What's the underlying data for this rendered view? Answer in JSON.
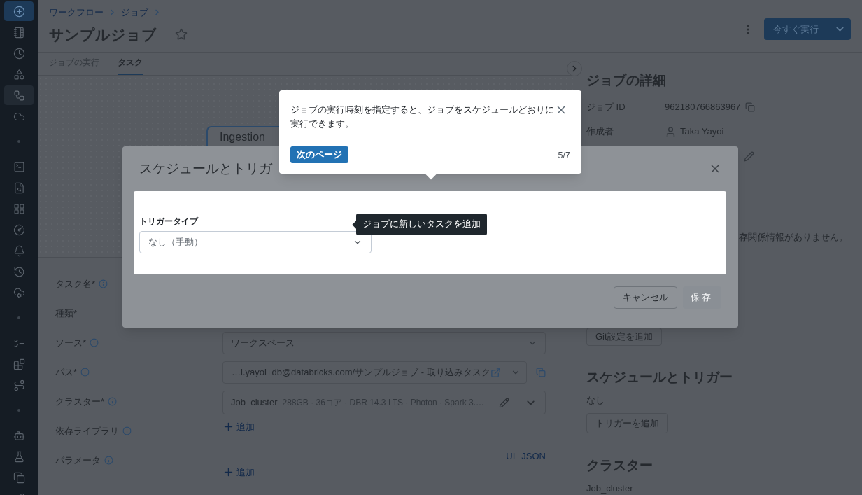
{
  "sidebar": {
    "groups": [
      [
        {
          "selected": false,
          "kind": "new"
        },
        {
          "selected": false
        },
        {
          "selected": false
        },
        {
          "selected": false
        },
        {
          "selected": true
        },
        {
          "selected": false
        }
      ],
      [
        {
          "selected": false
        },
        {
          "selected": false
        },
        {
          "selected": false
        },
        {
          "selected": false
        },
        {
          "selected": false
        },
        {
          "selected": false
        },
        {
          "selected": false
        }
      ],
      [
        {
          "selected": false
        },
        {
          "selected": false
        },
        {
          "selected": false
        }
      ],
      [
        {
          "selected": false
        },
        {
          "selected": false
        },
        {
          "selected": false
        },
        {
          "selected": false
        }
      ]
    ]
  },
  "header": {
    "breadcrumb": [
      "ワークフロー",
      "ジョブ"
    ],
    "title": "サンプルジョブ",
    "favorite": false,
    "run_button": "今すぐ実行"
  },
  "tabs": [
    {
      "label": "ジョブの実行",
      "selected": false
    },
    {
      "label": "タスク",
      "selected": true
    }
  ],
  "canvas": {
    "node": "Ingestion"
  },
  "form": [
    {
      "label": "タスク名*",
      "info": true,
      "kind": "hidden"
    },
    {
      "label": "種類*",
      "info": false,
      "kind": "hidden"
    },
    {
      "label": "ソース*",
      "info": true,
      "kind": "select",
      "value": "ワークスペース"
    },
    {
      "label": "パス*",
      "info": true,
      "kind": "path",
      "value": "…i.yayoi+db@databricks.com/サンプルジョブ - 取り込みタスク"
    },
    {
      "label": "クラスター*",
      "info": true,
      "kind": "cluster",
      "name": "Job_cluster",
      "detail": "288GB · 36コア · DBR 14.3 LTS · Photon · Spark 3.…"
    },
    {
      "label": "依存ライブラリ",
      "info": true,
      "kind": "add",
      "action": "追加"
    },
    {
      "label": "パラメータ",
      "info": true,
      "kind": "params",
      "modes": [
        "UI",
        "JSON"
      ],
      "action": "追加"
    }
  ],
  "details": {
    "title": "ジョブの詳細",
    "rows": [
      {
        "label": "ジョブ ID",
        "value": "962180766863967",
        "kind": "copy"
      },
      {
        "label": "作成者",
        "value": "Taka Yayoi",
        "kind": "user"
      }
    ],
    "dependencies_note": "存関係情報がありません。",
    "git_button": "Git設定を追加",
    "schedule": {
      "title": "スケジュールとトリガー",
      "value": "なし",
      "button": "トリガーを追加"
    },
    "cluster": {
      "title": "クラスター",
      "value": "Job_cluster"
    }
  },
  "modal": {
    "title": "スケジュールとトリガ",
    "trigger_label": "トリガータイプ",
    "trigger_value": "なし（手動）",
    "cancel": "キャンセル",
    "save": {
      "label": "保存",
      "disabled": true
    }
  },
  "tour": {
    "text": "ジョブの実行時刻を指定すると、ジョブをスケジュールどおりに実行できます。",
    "next": "次のページ",
    "step": "5/7"
  },
  "tooltip": "ジョブに新しいタスクを追加"
}
